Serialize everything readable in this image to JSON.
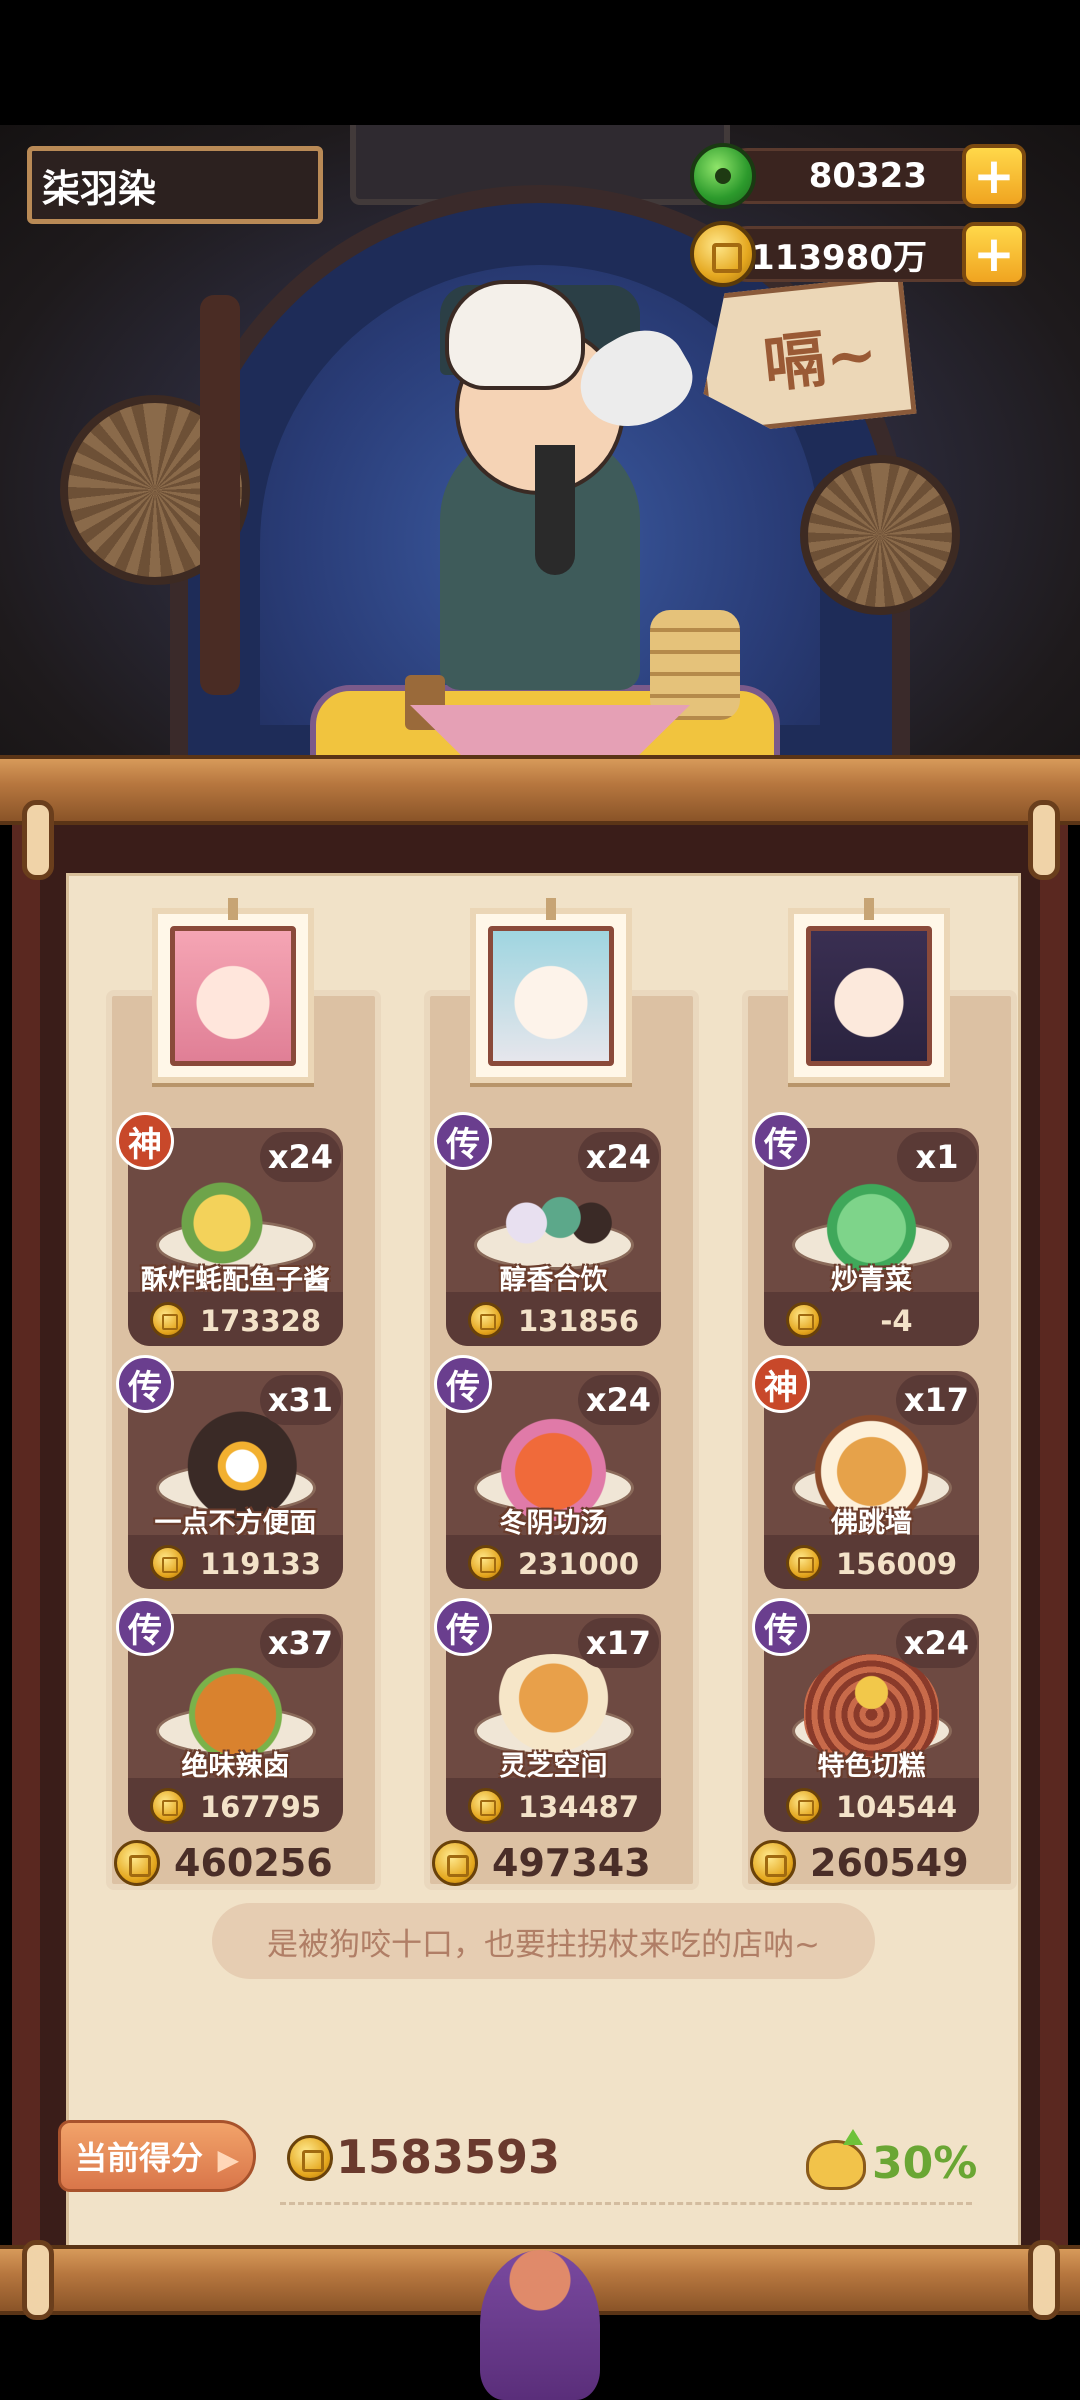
{
  "player": {
    "name": "柒羽染"
  },
  "currency": {
    "jade": {
      "value": "80323",
      "add_label": "+"
    },
    "gold": {
      "value": "113980万",
      "add_label": "+"
    }
  },
  "scene": {
    "speech": "嗝~"
  },
  "board": {
    "columns": [
      {
        "portrait": "portrait-pink-hair-girl",
        "dishes": [
          {
            "badge": "神",
            "qty": "x24",
            "name": "酥炸蚝配鱼子酱",
            "price": "173328"
          },
          {
            "badge": "传",
            "qty": "x31",
            "name": "一点不方便面",
            "price": "119133"
          },
          {
            "badge": "传",
            "qty": "x37",
            "name": "绝味辣卤",
            "price": "167795"
          }
        ],
        "total": "460256"
      },
      {
        "portrait": "portrait-white-hair-warrior",
        "dishes": [
          {
            "badge": "传",
            "qty": "x24",
            "name": "醇香合饮",
            "price": "131856"
          },
          {
            "badge": "传",
            "qty": "x24",
            "name": "冬阴功汤",
            "price": "231000"
          },
          {
            "badge": "传",
            "qty": "x17",
            "name": "灵芝空间",
            "price": "134487"
          }
        ],
        "total": "497343"
      },
      {
        "portrait": "portrait-dark-hair-girl",
        "dishes": [
          {
            "badge": "传",
            "qty": "x1",
            "name": "炒青菜",
            "price": "-4"
          },
          {
            "badge": "神",
            "qty": "x17",
            "name": "佛跳墙",
            "price": "156009"
          },
          {
            "badge": "传",
            "qty": "x24",
            "name": "特色切糕",
            "price": "104544"
          }
        ],
        "total": "260549"
      }
    ],
    "quote": "是被狗咬十口，也要拄拐杖来吃的店呐~"
  },
  "score": {
    "label": "当前得分",
    "arrow": "▶",
    "value": "1583593",
    "bonus": "30%"
  },
  "colors": {
    "badge_chuan": "#6a3e8e",
    "badge_shen": "#c8482a",
    "bonus_green": "#6aa634",
    "paper": "#f1e2c8"
  },
  "icons": [
    "jade-coin-icon",
    "gold-coin-icon",
    "plus-icon",
    "coin-icon",
    "bonus-bag-icon"
  ]
}
